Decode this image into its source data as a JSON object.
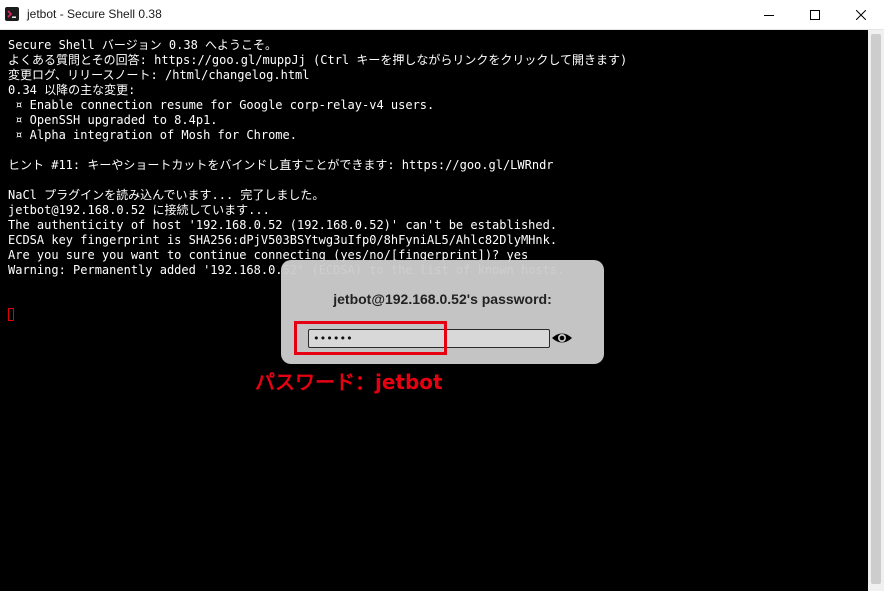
{
  "window": {
    "title": "jetbot - Secure Shell 0.38",
    "icon": "terminal-icon",
    "controls": [
      "minimize-icon",
      "maximize-icon",
      "close-icon"
    ]
  },
  "terminal": {
    "lines": [
      "Secure Shell バージョン 0.38 へようこそ。",
      "よくある質問とその回答: https://goo.gl/muppJj (Ctrl キーを押しながらリンクをクリックして開きます)",
      "変更ログ、リリースノート: /html/changelog.html",
      "0.34 以降の主な変更:",
      " ¤ Enable connection resume for Google corp-relay-v4 users.",
      " ¤ OpenSSH upgraded to 8.4p1.",
      " ¤ Alpha integration of Mosh for Chrome.",
      "",
      "ヒント #11: キーやショートカットをバインドし直すことができます: https://goo.gl/LWRndr",
      "",
      "NaCl プラグインを読み込んでいます... 完了しました。",
      "jetbot@192.168.0.52 に接続しています...",
      "The authenticity of host '192.168.0.52 (192.168.0.52)' can't be established.",
      "ECDSA key fingerprint is SHA256:dPjV503BSYtwg3uIfp0/8hFyniAL5/Ahlc82DlyMHnk.",
      "Are you sure you want to continue connecting (yes/no/[fingerprint])? yes",
      "Warning: Permanently added '192.168.0.52' (ECDSA) to the list of known hosts."
    ]
  },
  "password_dialog": {
    "prompt": "jetbot@192.168.0.52's password:",
    "value": "••••••",
    "reveal_icon": "eye-icon"
  },
  "annotation": {
    "label": "パスワード：jetbot",
    "color": "#e60012"
  }
}
